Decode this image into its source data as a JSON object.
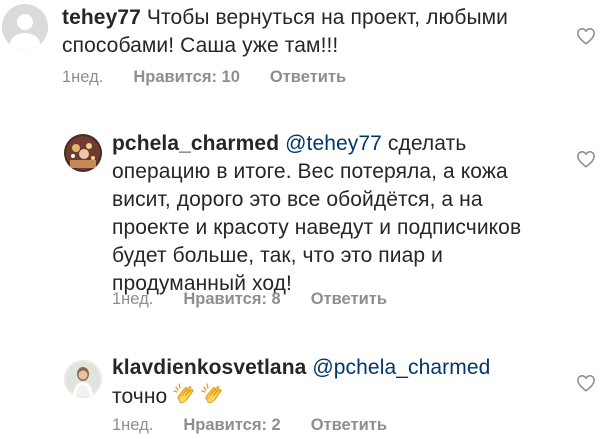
{
  "comments": [
    {
      "username": "tehey77",
      "mention": "",
      "text_lines": [
        "Чтобы вернуться на проект, любыми",
        "способами! Саша уже там!!!"
      ],
      "time": "1нед.",
      "likes": "Нравится: 10",
      "reply": "Ответить",
      "avatar_icon": "default-avatar-icon",
      "heart_icon": "heart-outline-icon"
    },
    {
      "username": "pchela_charmed",
      "mention": "@tehey77",
      "first_line_rest": "сделать",
      "text_lines": [
        "операцию в итоге. Вес потеряла, а кожа",
        "висит, дорого это все обойдётся, а на",
        "проекте и красоту наведут и подписчиков",
        "будет больше, так, что это пиар и",
        "продуманный ход!"
      ],
      "time": "1нед.",
      "likes": "Нравится: 8",
      "reply": "Ответить",
      "avatar_icon": "profile-photo-avatar",
      "heart_icon": "heart-outline-icon"
    },
    {
      "username": "klavdienkosvetlana",
      "mention": "@pchela_charmed",
      "text_lines": [
        "точно"
      ],
      "emoji": [
        "clapping-hands-emoji",
        "clapping-hands-emoji"
      ],
      "time": "1нед.",
      "likes": "Нравится: 2",
      "reply": "Ответить",
      "avatar_icon": "profile-photo-avatar",
      "heart_icon": "heart-outline-icon"
    }
  ],
  "colors": {
    "text": "#262626",
    "meta": "#8e8e8e",
    "mention": "#00376b",
    "avatar_bg": "#dbdbdb"
  }
}
